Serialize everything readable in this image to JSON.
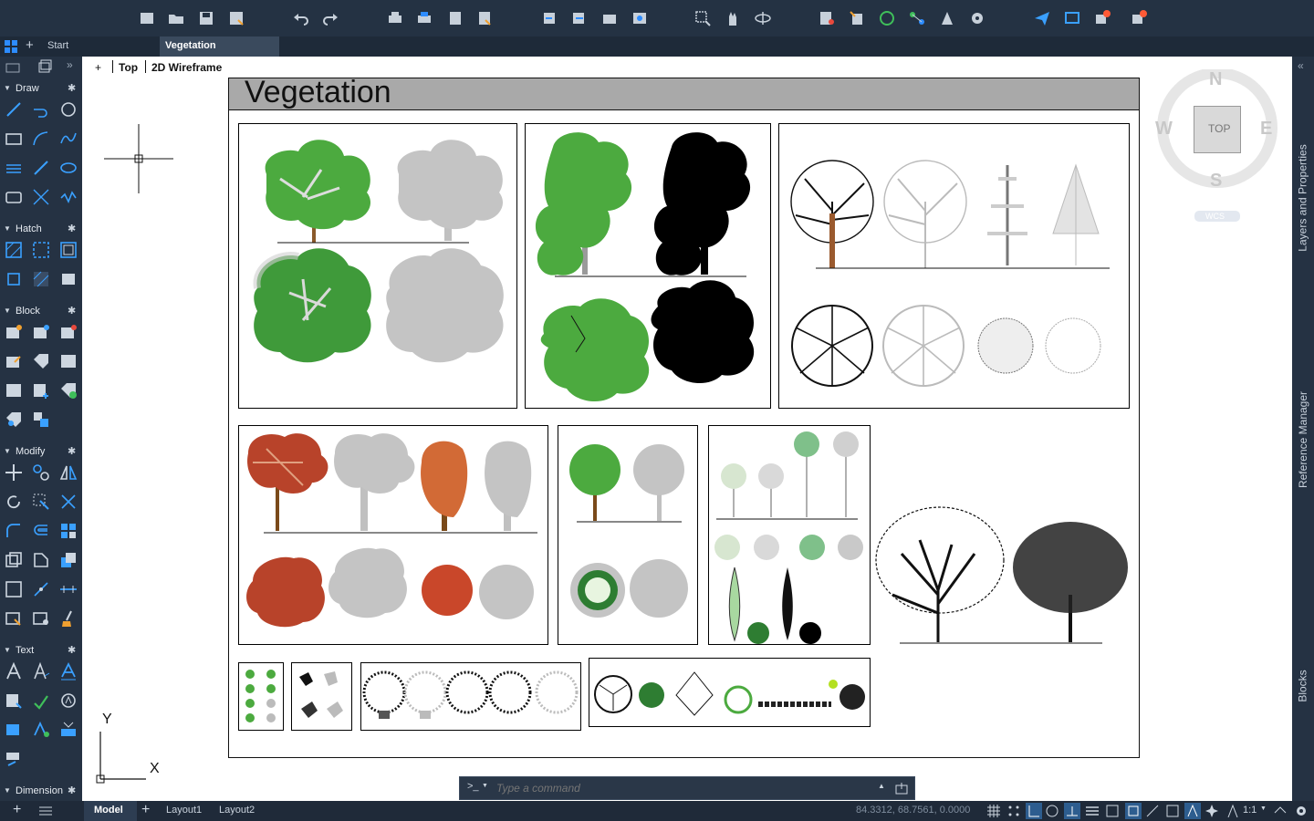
{
  "tabs": {
    "start": "Start",
    "document": "Vegetation"
  },
  "viewport": {
    "plus": "+",
    "view": "Top",
    "visual_style": "2D Wireframe"
  },
  "drawing": {
    "title": "Vegetation"
  },
  "viewcube": {
    "north": "N",
    "south": "S",
    "east": "E",
    "west": "W",
    "top": "TOP",
    "ucs": "WCS"
  },
  "ucs_icon": {
    "x": "X",
    "y": "Y"
  },
  "panels": {
    "draw": "Draw",
    "hatch": "Hatch",
    "block": "Block",
    "modify": "Modify",
    "text": "Text",
    "dimension": "Dimension"
  },
  "right_tabs": {
    "layers": "Layers and Properties",
    "reference": "Reference Manager",
    "blocks": "Blocks"
  },
  "command": {
    "prompt": ">_",
    "placeholder": "Type a command"
  },
  "layouts": {
    "model": "Model",
    "layout1": "Layout1",
    "layout2": "Layout2"
  },
  "status": {
    "coords": "84.3312,  68.7561, 0.0000",
    "scale": "1:1"
  },
  "colors": {
    "ui_bg": "#243243",
    "accent": "#2d8cff",
    "canvas": "#ffffff",
    "tree_green": "#3f8f3a",
    "autumn": "#b8432a"
  }
}
